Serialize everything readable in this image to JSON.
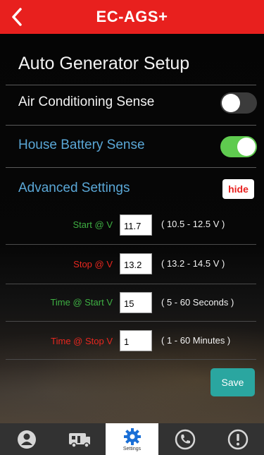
{
  "header": {
    "title": "EC-AGS+",
    "back_icon": "chevron-left-icon"
  },
  "page": {
    "title": "Auto Generator Setup"
  },
  "settings": {
    "air_conditioning": {
      "label": "Air Conditioning Sense",
      "enabled": false
    },
    "house_battery": {
      "label": "House Battery Sense",
      "enabled": true
    },
    "advanced": {
      "label": "Advanced Settings",
      "hide_label": "hide"
    }
  },
  "params": [
    {
      "label": "Start @ V",
      "value": "11.7",
      "range": "( 10.5 - 12.5 V )",
      "color": "#3fb043"
    },
    {
      "label": "Stop @ V",
      "value": "13.2",
      "range": "( 13.2 - 14.5 V )",
      "color": "#e8271f"
    },
    {
      "label": "Time @ Start V",
      "value": "15",
      "range": "( 5 - 60 Seconds )",
      "color": "#3fb043"
    },
    {
      "label": "Time @ Stop V",
      "value": "1",
      "range": "( 1 - 60 Minutes )",
      "color": "#e8271f"
    }
  ],
  "save_label": "Save",
  "tabs": [
    {
      "icon": "user-icon",
      "label": ""
    },
    {
      "icon": "rv-icon",
      "label": ""
    },
    {
      "icon": "gear-icon",
      "label": "Settings",
      "active": true
    },
    {
      "icon": "phone-icon",
      "label": ""
    },
    {
      "icon": "alert-icon",
      "label": ""
    }
  ],
  "colors": {
    "header": "#e8201e",
    "accent_blue": "#5aa7d6",
    "toggle_on": "#5fcb4f",
    "save": "#2aa6a0"
  }
}
